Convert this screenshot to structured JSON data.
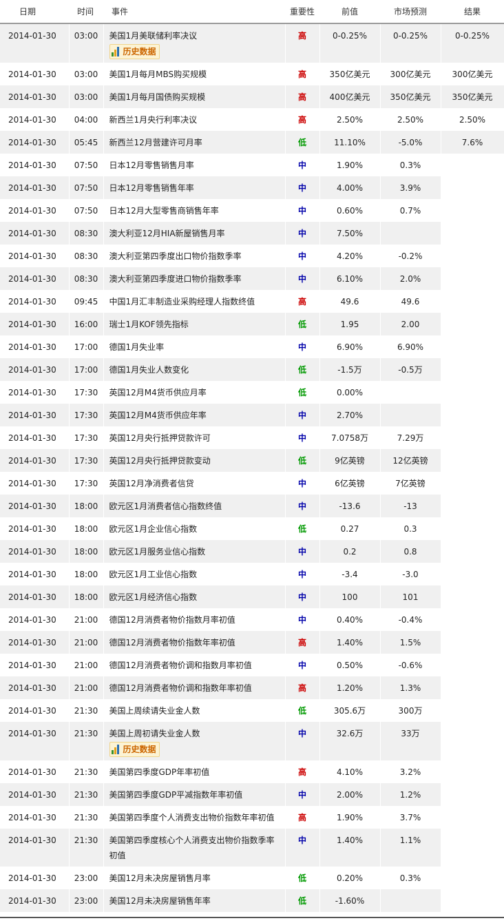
{
  "columns": {
    "date": "日期",
    "time": "时间",
    "event": "事件",
    "importance": "重要性",
    "previous": "前值",
    "forecast": "市场预测",
    "result": "结果"
  },
  "history_button_label": "历史数据",
  "importance_colors": {
    "高": "#cc0000",
    "中": "#0000aa",
    "低": "#009900"
  },
  "rows": [
    {
      "date": "2014-01-30",
      "time": "03:00",
      "event": "美国1月美联储利率决议",
      "importance": "高",
      "previous": "0-0.25%",
      "forecast": "0-0.25%",
      "result": "0-0.25%",
      "has_history": true
    },
    {
      "date": "2014-01-30",
      "time": "03:00",
      "event": "美国1月每月MBS购买规模",
      "importance": "高",
      "previous": "350亿美元",
      "forecast": "300亿美元",
      "result": "300亿美元",
      "has_history": false
    },
    {
      "date": "2014-01-30",
      "time": "03:00",
      "event": "美国1月每月国债购买规模",
      "importance": "高",
      "previous": "400亿美元",
      "forecast": "350亿美元",
      "result": "350亿美元",
      "has_history": false
    },
    {
      "date": "2014-01-30",
      "time": "04:00",
      "event": "新西兰1月央行利率决议",
      "importance": "高",
      "previous": "2.50%",
      "forecast": "2.50%",
      "result": "2.50%",
      "has_history": false
    },
    {
      "date": "2014-01-30",
      "time": "05:45",
      "event": "新西兰12月营建许可月率",
      "importance": "低",
      "previous": "11.10%",
      "forecast": "-5.0%",
      "result": "7.6%",
      "has_history": false
    },
    {
      "date": "2014-01-30",
      "time": "07:50",
      "event": "日本12月零售销售月率",
      "importance": "中",
      "previous": "1.90%",
      "forecast": "0.3%",
      "result": "",
      "has_history": false
    },
    {
      "date": "2014-01-30",
      "time": "07:50",
      "event": "日本12月零售销售年率",
      "importance": "中",
      "previous": "4.00%",
      "forecast": "3.9%",
      "result": "",
      "has_history": false
    },
    {
      "date": "2014-01-30",
      "time": "07:50",
      "event": "日本12月大型零售商销售年率",
      "importance": "中",
      "previous": "0.60%",
      "forecast": "0.7%",
      "result": "",
      "has_history": false
    },
    {
      "date": "2014-01-30",
      "time": "08:30",
      "event": "澳大利亚12月HIA新屋销售月率",
      "importance": "中",
      "previous": "7.50%",
      "forecast": "",
      "result": "",
      "has_history": false
    },
    {
      "date": "2014-01-30",
      "time": "08:30",
      "event": "澳大利亚第四季度出口物价指数季率",
      "importance": "中",
      "previous": "4.20%",
      "forecast": "-0.2%",
      "result": "",
      "has_history": false
    },
    {
      "date": "2014-01-30",
      "time": "08:30",
      "event": "澳大利亚第四季度进口物价指数季率",
      "importance": "中",
      "previous": "6.10%",
      "forecast": "2.0%",
      "result": "",
      "has_history": false
    },
    {
      "date": "2014-01-30",
      "time": "09:45",
      "event": "中国1月汇丰制造业采购经理人指数终值",
      "importance": "高",
      "previous": "49.6",
      "forecast": "49.6",
      "result": "",
      "has_history": false
    },
    {
      "date": "2014-01-30",
      "time": "16:00",
      "event": "瑞士1月KOF领先指标",
      "importance": "低",
      "previous": "1.95",
      "forecast": "2.00",
      "result": "",
      "has_history": false
    },
    {
      "date": "2014-01-30",
      "time": "17:00",
      "event": "德国1月失业率",
      "importance": "中",
      "previous": "6.90%",
      "forecast": "6.90%",
      "result": "",
      "has_history": false
    },
    {
      "date": "2014-01-30",
      "time": "17:00",
      "event": "德国1月失业人数变化",
      "importance": "低",
      "previous": "-1.5万",
      "forecast": "-0.5万",
      "result": "",
      "has_history": false
    },
    {
      "date": "2014-01-30",
      "time": "17:30",
      "event": "英国12月M4货币供应月率",
      "importance": "低",
      "previous": "0.00%",
      "forecast": "",
      "result": "",
      "has_history": false
    },
    {
      "date": "2014-01-30",
      "time": "17:30",
      "event": "英国12月M4货币供应年率",
      "importance": "中",
      "previous": "2.70%",
      "forecast": "",
      "result": "",
      "has_history": false
    },
    {
      "date": "2014-01-30",
      "time": "17:30",
      "event": "英国12月央行抵押贷款许可",
      "importance": "中",
      "previous": "7.0758万",
      "forecast": "7.29万",
      "result": "",
      "has_history": false
    },
    {
      "date": "2014-01-30",
      "time": "17:30",
      "event": "英国12月央行抵押贷款变动",
      "importance": "低",
      "previous": "9亿英镑",
      "forecast": "12亿英镑",
      "result": "",
      "has_history": false
    },
    {
      "date": "2014-01-30",
      "time": "17:30",
      "event": "英国12月净消费者信贷",
      "importance": "中",
      "previous": "6亿英镑",
      "forecast": "7亿英镑",
      "result": "",
      "has_history": false
    },
    {
      "date": "2014-01-30",
      "time": "18:00",
      "event": "欧元区1月消费者信心指数终值",
      "importance": "中",
      "previous": "-13.6",
      "forecast": "-13",
      "result": "",
      "has_history": false
    },
    {
      "date": "2014-01-30",
      "time": "18:00",
      "event": "欧元区1月企业信心指数",
      "importance": "低",
      "previous": "0.27",
      "forecast": "0.3",
      "result": "",
      "has_history": false
    },
    {
      "date": "2014-01-30",
      "time": "18:00",
      "event": "欧元区1月服务业信心指数",
      "importance": "中",
      "previous": "0.2",
      "forecast": "0.8",
      "result": "",
      "has_history": false
    },
    {
      "date": "2014-01-30",
      "time": "18:00",
      "event": "欧元区1月工业信心指数",
      "importance": "中",
      "previous": "-3.4",
      "forecast": "-3.0",
      "result": "",
      "has_history": false
    },
    {
      "date": "2014-01-30",
      "time": "18:00",
      "event": "欧元区1月经济信心指数",
      "importance": "中",
      "previous": "100",
      "forecast": "101",
      "result": "",
      "has_history": false
    },
    {
      "date": "2014-01-30",
      "time": "21:00",
      "event": "德国12月消费者物价指数月率初值",
      "importance": "中",
      "previous": "0.40%",
      "forecast": "-0.4%",
      "result": "",
      "has_history": false
    },
    {
      "date": "2014-01-30",
      "time": "21:00",
      "event": "德国12月消费者物价指数年率初值",
      "importance": "高",
      "previous": "1.40%",
      "forecast": "1.5%",
      "result": "",
      "has_history": false
    },
    {
      "date": "2014-01-30",
      "time": "21:00",
      "event": "德国12月消费者物价调和指数月率初值",
      "importance": "中",
      "previous": "0.50%",
      "forecast": "-0.6%",
      "result": "",
      "has_history": false
    },
    {
      "date": "2014-01-30",
      "time": "21:00",
      "event": "德国12月消费者物价调和指数年率初值",
      "importance": "高",
      "previous": "1.20%",
      "forecast": "1.3%",
      "result": "",
      "has_history": false
    },
    {
      "date": "2014-01-30",
      "time": "21:30",
      "event": "美国上周续请失业金人数",
      "importance": "低",
      "previous": "305.6万",
      "forecast": "300万",
      "result": "",
      "has_history": false
    },
    {
      "date": "2014-01-30",
      "time": "21:30",
      "event": "美国上周初请失业金人数",
      "importance": "中",
      "previous": "32.6万",
      "forecast": "33万",
      "result": "",
      "has_history": true
    },
    {
      "date": "2014-01-30",
      "time": "21:30",
      "event": "美国第四季度GDP年率初值",
      "importance": "高",
      "previous": "4.10%",
      "forecast": "3.2%",
      "result": "",
      "has_history": false
    },
    {
      "date": "2014-01-30",
      "time": "21:30",
      "event": "美国第四季度GDP平减指数年率初值",
      "importance": "中",
      "previous": "2.00%",
      "forecast": "1.2%",
      "result": "",
      "has_history": false
    },
    {
      "date": "2014-01-30",
      "time": "21:30",
      "event": "美国第四季度个人消费支出物价指数年率初值",
      "importance": "高",
      "previous": "1.90%",
      "forecast": "3.7%",
      "result": "",
      "has_history": false
    },
    {
      "date": "2014-01-30",
      "time": "21:30",
      "event": "美国第四季度核心个人消费支出物价指数季率初值",
      "importance": "中",
      "previous": "1.40%",
      "forecast": "1.1%",
      "result": "",
      "has_history": false
    },
    {
      "date": "2014-01-30",
      "time": "23:00",
      "event": "美国12月未决房屋销售月率",
      "importance": "低",
      "previous": "0.20%",
      "forecast": "0.3%",
      "result": "",
      "has_history": false
    },
    {
      "date": "2014-01-30",
      "time": "23:00",
      "event": "美国12月未决房屋销售年率",
      "importance": "低",
      "previous": "-1.60%",
      "forecast": "",
      "result": "",
      "has_history": false
    }
  ]
}
